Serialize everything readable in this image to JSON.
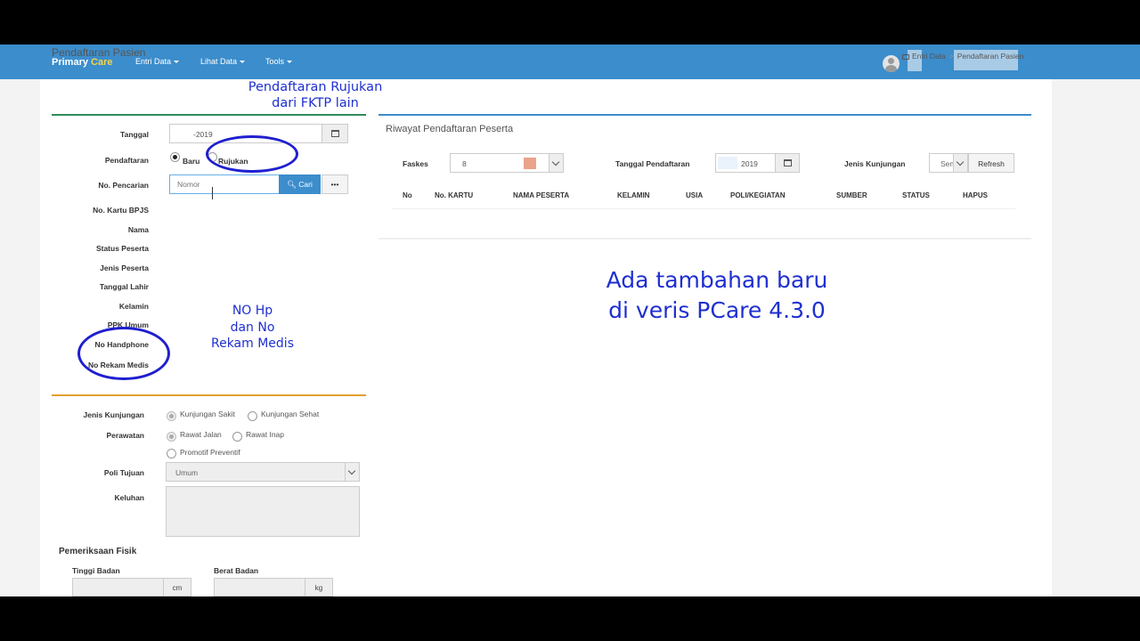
{
  "navbar": {
    "brand_primary": "Primary",
    "brand_accent": "Care",
    "menu": [
      {
        "label": "Entri Data"
      },
      {
        "label": "Lihat Data"
      },
      {
        "label": "Tools"
      }
    ]
  },
  "page": {
    "title": "Pendaftaran Pasien",
    "breadcrumb": [
      "Entri Data",
      "Pendaftaran Pasien"
    ]
  },
  "form": {
    "tanggal_label": "Tanggal",
    "tanggal_value": "-2019",
    "pendaftaran_label": "Pendaftaran",
    "radio_baru": "Baru",
    "radio_rujukan": "Rujukan",
    "pencarian_label": "No. Pencarian",
    "pencarian_placeholder": "Nomor",
    "cari_button": "Cari",
    "more_button": "•••",
    "fields": [
      "No. Kartu BPJS",
      "Nama",
      "Status Peserta",
      "Jenis Peserta",
      "Tanggal Lahir",
      "Kelamin",
      "PPK Umum",
      "No Handphone",
      "No Rekam Medis"
    ]
  },
  "kunjungan": {
    "jenis_label": "Jenis Kunjungan",
    "jenis_options": [
      "Kunjungan Sakit",
      "Kunjungan Sehat"
    ],
    "perawatan_label": "Perawatan",
    "perawatan_options": [
      "Rawat Jalan",
      "Rawat Inap",
      "Promotif Preventif"
    ],
    "poli_label": "Poli Tujuan",
    "poli_value": "Umum",
    "keluhan_label": "Keluhan",
    "pemeriksaan_title": "Pemeriksaan Fisik",
    "tinggi_label": "Tinggi Badan",
    "tinggi_unit": "cm",
    "berat_label": "Berat Badan",
    "berat_unit": "kg"
  },
  "riwayat": {
    "title": "Riwayat Pendaftaran Peserta",
    "faskes_label": "Faskes",
    "faskes_value": "8",
    "tanggal_label": "Tanggal Pendaftaran",
    "tanggal_value": "2019",
    "jenis_label": "Jenis Kunjungan",
    "jenis_value": "Sen",
    "refresh_button": "Refresh",
    "columns": [
      "No",
      "No. KARTU",
      "NAMA PESERTA",
      "KELAMIN",
      "USIA",
      "POLI/KEGIATAN",
      "SUMBER",
      "STATUS",
      "HAPUS"
    ]
  },
  "annotations": {
    "rujukan_line1": "Pendaftaran Rujukan",
    "rujukan_line2": "dari FKTP lain",
    "nohp_line1": "NO Hp",
    "nohp_line2": "dan No",
    "nohp_line3": "Rekam Medis",
    "main_line1": "Ada tambahan baru",
    "main_line2": "di veris PCare 4.3.0"
  },
  "colors": {
    "navbar": "#3c8dcc",
    "brand_accent": "#f5d547",
    "panel_green": "#2e8b57",
    "panel_orange": "#e0a030",
    "panel_blue": "#3c8dcc",
    "annotation": "#1f2fd0"
  },
  "icons": [
    "calendar-icon",
    "search-icon",
    "home-icon",
    "user-avatar-icon",
    "chevron-down-icon"
  ]
}
